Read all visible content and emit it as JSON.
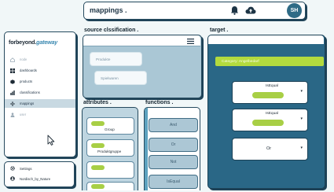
{
  "header": {
    "title": "mappings .",
    "avatar_initials": "SH",
    "icons": [
      "bell-icon",
      "cloud-upload-icon"
    ]
  },
  "sidebar": {
    "brand_main": "forbeyond.",
    "brand_accent": "gateway",
    "items": [
      {
        "label": "node",
        "icon": "home-icon",
        "muted": true
      },
      {
        "label": "dashboards",
        "icon": "grid-icon",
        "muted": false
      },
      {
        "label": "products",
        "icon": "cube-icon",
        "muted": false
      },
      {
        "label": "classifications",
        "icon": "chart-icon",
        "muted": false
      },
      {
        "label": "mappings",
        "icon": "sparkle-icon",
        "muted": false,
        "active": true
      },
      {
        "label": "user",
        "icon": "person-icon",
        "muted": true
      }
    ],
    "settings_label": "Settings",
    "user_label": "Nordisch_by_Nature"
  },
  "source": {
    "title": "source clssification .",
    "chips": [
      "Produkte",
      "Spielwaren"
    ]
  },
  "attributes": {
    "title": "attributes .",
    "items": [
      "Group",
      "Produktgruppe",
      "",
      ""
    ]
  },
  "functions": {
    "title": "functions .",
    "items": [
      "And",
      "Or",
      "Not",
      "IsEqual"
    ]
  },
  "target": {
    "title": "target .",
    "category_bar": "Category: Angelbedarf",
    "cards": [
      "IsEqual",
      "IsEqual",
      "Or"
    ]
  },
  "colors": {
    "accent_green": "#a8cf45",
    "navy": "#2a6786",
    "light_blue": "#aac7d5"
  }
}
